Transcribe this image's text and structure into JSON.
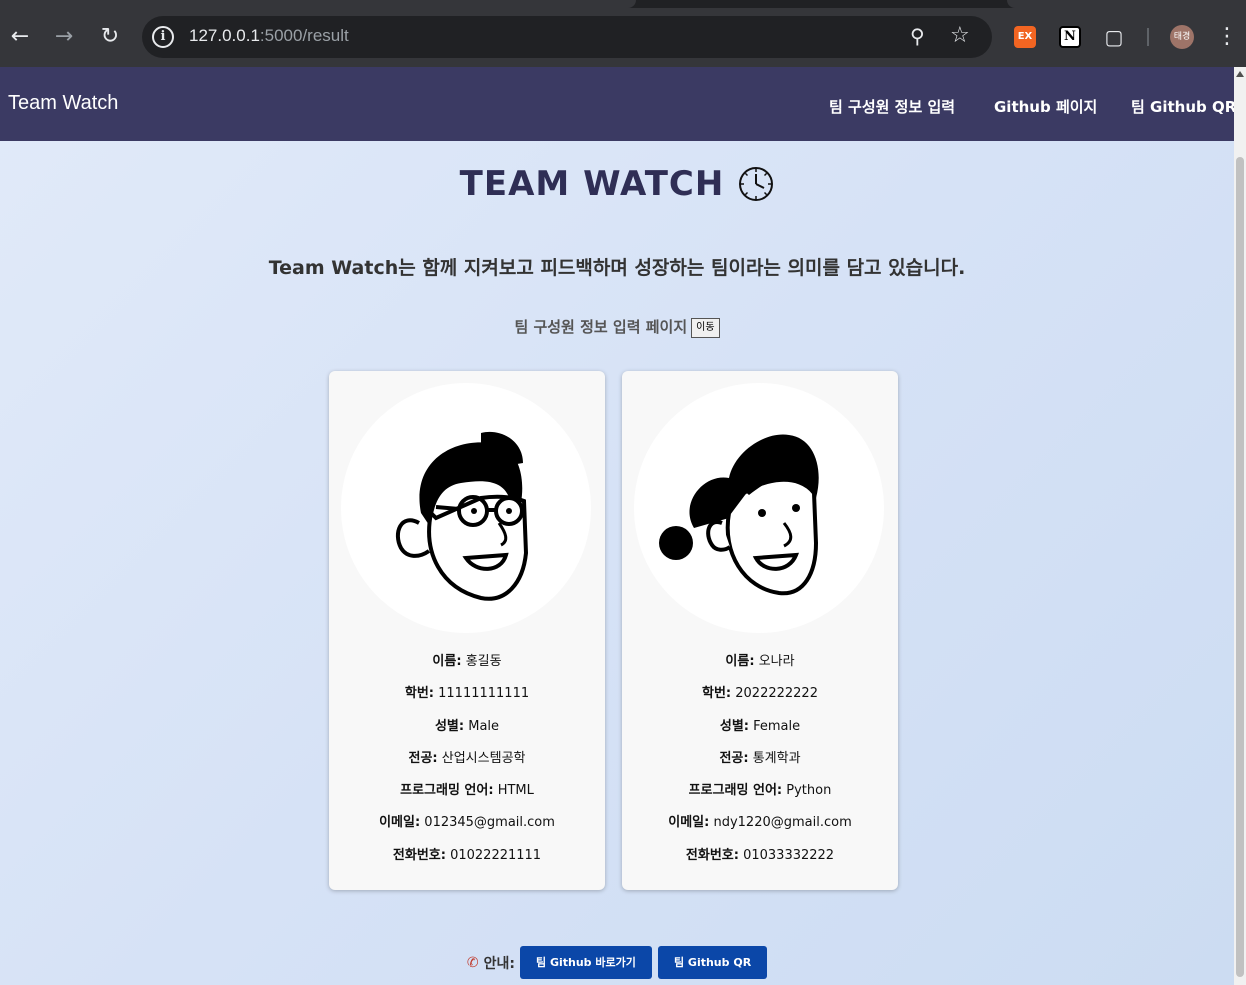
{
  "browser": {
    "url_host": "127.0.0.1",
    "url_path": ":5000/result",
    "ext_ex_label": "EX",
    "ext_notion_label": "N",
    "profile_label": "태경"
  },
  "navbar": {
    "brand": "Team Watch",
    "links": [
      "팀 구성원 정보 입력",
      "Github 페이지",
      "팀 Github QR"
    ]
  },
  "header": {
    "title": "TEAM WATCH",
    "subtitle": "Team Watch는 함께 지켜보고 피드백하며 성장하는 팀이라는 의미를 담고 있습니다."
  },
  "goto": {
    "label": "팀 구성원 정보 입력 페이지",
    "button": "이동"
  },
  "members": [
    {
      "fields": [
        {
          "k": "이름:",
          "v": "홍길동"
        },
        {
          "k": "학번:",
          "v": "11111111111"
        },
        {
          "k": "성별:",
          "v": "Male"
        },
        {
          "k": "전공:",
          "v": "산업시스템공학"
        },
        {
          "k": "프로그래밍 언어:",
          "v": "HTML"
        },
        {
          "k": "이메일:",
          "v": "012345@gmail.com"
        },
        {
          "k": "전화번호:",
          "v": "01022221111"
        }
      ]
    },
    {
      "fields": [
        {
          "k": "이름:",
          "v": "오나라"
        },
        {
          "k": "학번:",
          "v": "2022222222"
        },
        {
          "k": "성별:",
          "v": "Female"
        },
        {
          "k": "전공:",
          "v": "통계학과"
        },
        {
          "k": "프로그래밍 언어:",
          "v": "Python"
        },
        {
          "k": "이메일:",
          "v": "ndy1220@gmail.com"
        },
        {
          "k": "전화번호:",
          "v": "01033332222"
        }
      ]
    }
  ],
  "footer": {
    "label": "안내:",
    "buttons": [
      "팀 Github 바로가기",
      "팀 Github QR"
    ]
  },
  "colors": {
    "navbar": "#3b3a63",
    "title": "#2f2e55",
    "button_blue": "#0b47a8"
  }
}
